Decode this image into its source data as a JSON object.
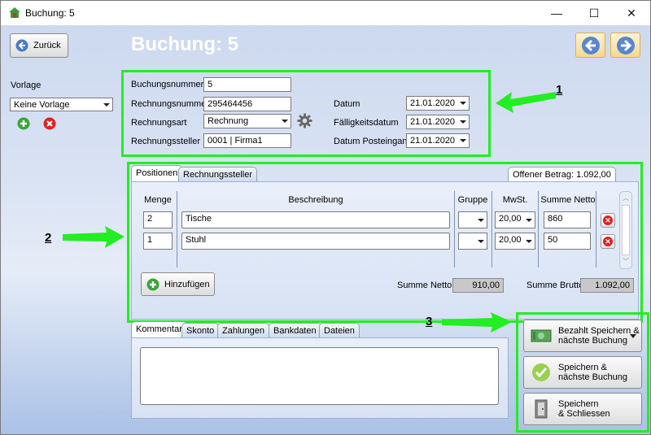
{
  "window": {
    "title": "Buchung: 5"
  },
  "header": {
    "back_label": "Zurück",
    "page_title": "Buchung: 5"
  },
  "vorlage": {
    "label": "Vorlage",
    "selected": "Keine Vorlage"
  },
  "annotations": {
    "one": "1",
    "two": "2",
    "three": "3"
  },
  "form": {
    "buchungsnummer_label": "Buchungsnummer",
    "buchungsnummer": "5",
    "rechnungsnummer_label": "Rechnungsnummer",
    "rechnungsnummer": "295464456",
    "rechnungsart_label": "Rechnungsart",
    "rechnungsart": "Rechnung",
    "rechnungssteller_label": "Rechnungssteller",
    "rechnungssteller": "0001 | Firma1",
    "datum_label": "Datum",
    "datum": "21.01.2020",
    "faelligkeit_label": "Fälligkeitsdatum",
    "faelligkeit": "21.01.2020",
    "posteingang_label": "Datum Posteingang",
    "posteingang": "21.01.2020"
  },
  "positions": {
    "tabs": [
      "Positionen",
      "Rechnungssteller"
    ],
    "offener_betrag": "Offener Betrag: 1.092,00",
    "columns": {
      "menge": "Menge",
      "beschreibung": "Beschreibung",
      "gruppe": "Gruppe",
      "mwst": "MwSt.",
      "summe_netto": "Summe Netto"
    },
    "rows": [
      {
        "menge": "2",
        "beschreibung": "Tische",
        "gruppe": "",
        "mwst": "20,00",
        "netto": "860"
      },
      {
        "menge": "1",
        "beschreibung": "Stuhl",
        "gruppe": "",
        "mwst": "20,00",
        "netto": "50"
      }
    ],
    "add_label": "Hinzufügen",
    "summe_netto_label": "Summe Netto",
    "summe_netto": "910,00",
    "summe_brutto_label": "Summe Brutto",
    "summe_brutto": "1.092,00"
  },
  "bottom_tabs": [
    "Kommentar",
    "Skonto",
    "Zahlungen",
    "Bankdaten",
    "Dateien"
  ],
  "actions": {
    "bezahlt_line1": "Bezahlt Speichern &",
    "bezahlt_line2": "nächste Buchung",
    "speichern_next_line1": "Speichern &",
    "speichern_next_line2": "nächste Buchung",
    "speichern_close_line1": "Speichern",
    "speichern_close_line2": "& Schliessen"
  },
  "colors": {
    "highlight": "#22ee22",
    "nav_accent": "#f0c040",
    "title_text": "#ffffff"
  }
}
